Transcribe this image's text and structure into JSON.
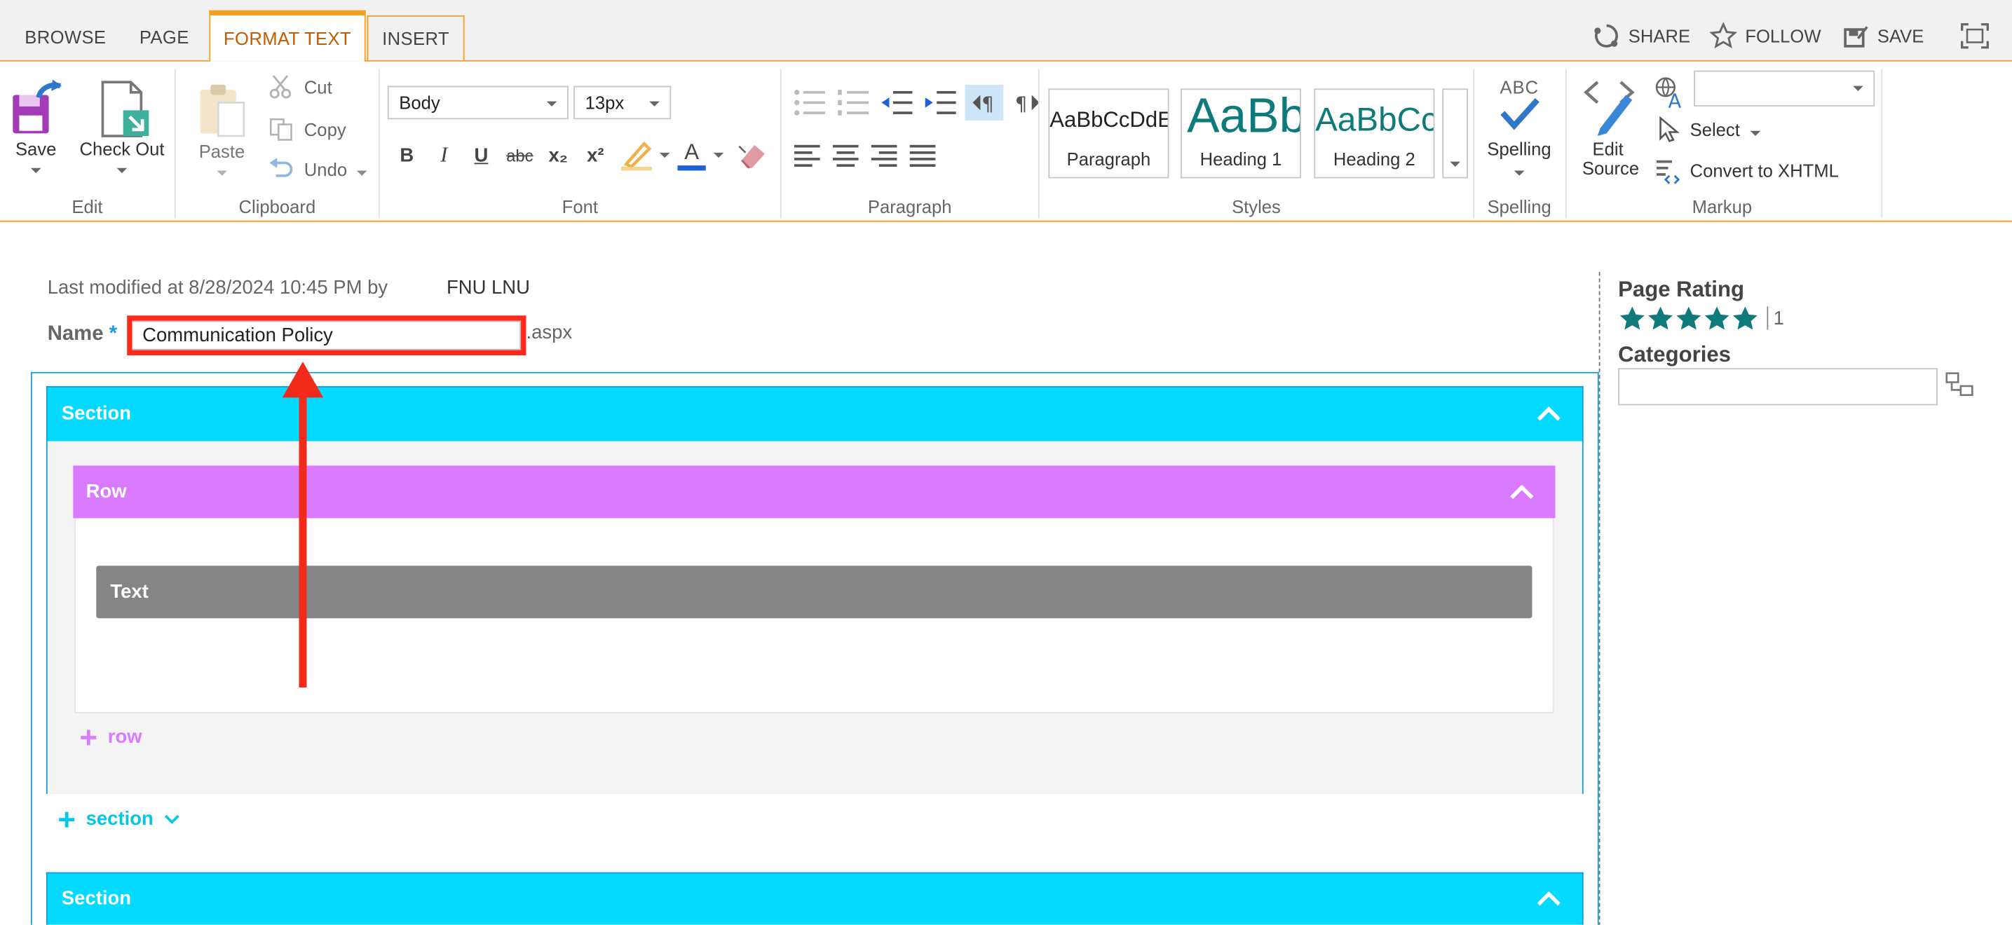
{
  "tabs": [
    {
      "label": "BROWSE"
    },
    {
      "label": "PAGE"
    },
    {
      "label": "FORMAT TEXT"
    },
    {
      "label": "INSERT"
    }
  ],
  "top_actions": {
    "share": "SHARE",
    "follow": "FOLLOW",
    "save": "SAVE"
  },
  "ribbon": {
    "edit": {
      "save": "Save",
      "check_out": "Check Out",
      "group": "Edit"
    },
    "clipboard": {
      "paste": "Paste",
      "cut": "Cut",
      "copy": "Copy",
      "undo": "Undo",
      "group": "Clipboard"
    },
    "font": {
      "style_value": "Body",
      "size_value": "13px",
      "group": "Font",
      "buttons": {
        "bold": "B",
        "italic": "I",
        "underline": "U",
        "strike": "abc",
        "sub": "x₂",
        "sup": "x²",
        "color": "A"
      }
    },
    "paragraph": {
      "group": "Paragraph"
    },
    "styles": {
      "group": "Styles",
      "items": [
        {
          "sample": "AaBbCcDdE",
          "name": "Paragraph"
        },
        {
          "sample": "AaBb",
          "name": "Heading 1"
        },
        {
          "sample": "AaBbCc",
          "name": "Heading 2"
        }
      ]
    },
    "spelling": {
      "abc": "ABC",
      "label": "Spelling",
      "group": "Spelling"
    },
    "markup": {
      "edit_source_1": "Edit",
      "edit_source_2": "Source",
      "select": "Select",
      "convert": "Convert to XHTML",
      "group": "Markup"
    }
  },
  "page": {
    "modified_text": "Last modified at 8/28/2024 10:45 PM by",
    "modified_user": "FNU LNU",
    "name_label": "Name",
    "required_mark": "*",
    "name_value": "Communication Policy",
    "extension": ".aspx"
  },
  "editor": {
    "section_label": "Section",
    "row_label": "Row",
    "text_label": "Text",
    "add_row": "row",
    "add_section": "section",
    "section2_label": "Section"
  },
  "side": {
    "rating_title": "Page Rating",
    "rating_value": 5,
    "rating_count": "1",
    "categories_title": "Categories"
  },
  "colors": {
    "accent_orange": "#f4a122",
    "section_cyan": "#04d9ff",
    "row_purple": "#da7bff",
    "text_gray": "#858585",
    "star_teal": "#0f7a7a",
    "annotation_red": "#f02b1b"
  }
}
